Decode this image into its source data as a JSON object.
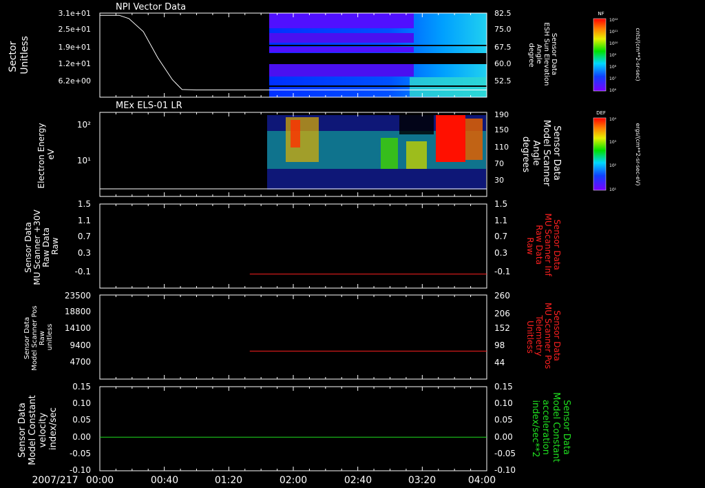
{
  "date_label": "2007/217",
  "time_ticks": [
    "00:00",
    "00:40",
    "01:20",
    "02:00",
    "02:40",
    "03:20",
    "04:00"
  ],
  "colors": {
    "background": "#000000",
    "axis": "#ffffff",
    "red_label": "#ff2020",
    "green_label": "#20e020"
  },
  "colorbars": [
    {
      "tag": "NF",
      "ticks": [
        "10¹²",
        "10¹¹",
        "10¹⁰",
        "10⁹",
        "10⁸",
        "10⁷",
        "10⁶"
      ],
      "unit": "cnts/(cm**2-sr-sec)"
    },
    {
      "tag": "DEF",
      "ticks": [
        "10⁴",
        "10³",
        "10²",
        "10¹"
      ],
      "unit": "ergs/(cm**2-sr-sec-eV)"
    }
  ],
  "chart_data": [
    {
      "type": "heatmap",
      "title": "NPI Vector Data",
      "ylabel_left": [
        "Sector",
        "Unitless"
      ],
      "yticks_left": [
        "3.1e+01",
        "2.5e+01",
        "1.9e+01",
        "1.2e+01",
        "6.2e+00"
      ],
      "ylabel_right": [
        "Sensor Data",
        "ESH Sun Elevation",
        "Angle",
        "degree"
      ],
      "yticks_right": [
        "82.5",
        "75.0",
        "67.5",
        "60.0",
        "52.5"
      ],
      "line": {
        "name": "ESH Sun Elevation Angle",
        "unit": "degree",
        "x_hours": [
          0.0,
          0.2,
          0.3,
          0.45,
          0.6,
          0.75,
          0.85,
          1.0,
          2.0,
          3.0,
          4.0
        ],
        "y": [
          84.5,
          84.5,
          83.0,
          77.0,
          65.0,
          55.0,
          50.5,
          50.3,
          50.3,
          50.3,
          50.3
        ]
      },
      "data_start_hours": 1.58
    },
    {
      "type": "heatmap",
      "title": "MEx ELS-01 LR",
      "ylabel_left": [
        "Electron Energy",
        "eV"
      ],
      "yticks_left": [
        "10²",
        "10¹"
      ],
      "ylabel_right": [
        "Sensor Data",
        "Model Scanner",
        "Angle",
        "degrees"
      ],
      "yticks_right": [
        "190",
        "150",
        "110",
        "70",
        "30"
      ],
      "line": {
        "name": "Model Scanner Angle",
        "unit": "degrees",
        "x_hours": [
          0.0,
          4.0
        ],
        "y": [
          2,
          2
        ]
      },
      "data_start_hours": 1.58
    },
    {
      "type": "line",
      "ylabel_left": [
        "Sensor Data",
        "MU Scanner +30V",
        "Raw Data",
        "Raw"
      ],
      "yticks_left": [
        "1.5",
        "1.1",
        "0.7",
        "0.3",
        "-0.1"
      ],
      "ylabel_right": [
        "Sensor Data",
        "MU Scanner Inf",
        "Raw Data",
        "Raw"
      ],
      "yticks_right": [
        "1.5",
        "1.1",
        "0.7",
        "0.3",
        "-0.1"
      ],
      "ylim": [
        -0.3,
        1.5
      ],
      "series": [
        {
          "name": "MU Scanner Inf Raw Data",
          "x_hours": [
            1.55,
            4.0
          ],
          "y": [
            0.0,
            0.0
          ]
        }
      ]
    },
    {
      "type": "line",
      "ylabel_left": [
        "Sensor Data",
        "Model Scanner Pos",
        "Raw",
        "unitless"
      ],
      "yticks_left": [
        "23500",
        "18800",
        "14100",
        "9400",
        "4700"
      ],
      "ylabel_right": [
        "Sensor Data",
        "MU Scanner Pos",
        "Telemetry",
        "Unitless"
      ],
      "yticks_right": [
        "260",
        "206",
        "152",
        "98",
        "44"
      ],
      "ylim": [
        17,
        260
      ],
      "series": [
        {
          "name": "MU Scanner Pos Telemetry",
          "x_hours": [
            1.55,
            4.0
          ],
          "y": [
            98,
            98
          ]
        }
      ]
    },
    {
      "type": "line",
      "ylabel_left": [
        "Sensor Data",
        "Model Constant",
        "velocity",
        "index/sec"
      ],
      "yticks_left": [
        "0.15",
        "0.10",
        "0.05",
        "0.00",
        "-0.05",
        "-0.10"
      ],
      "ylabel_right": [
        "Sensor Data",
        "Model Constant",
        "acceleration",
        "index/sec**2"
      ],
      "yticks_right": [
        "0.15",
        "0.10",
        "0.05",
        "0.00",
        "-0.05",
        "-0.10"
      ],
      "ylim": [
        -0.1,
        0.15
      ],
      "series": [
        {
          "name": "Model Constant acceleration",
          "x_hours": [
            0.0,
            4.0
          ],
          "y": [
            0.0,
            0.0
          ]
        }
      ]
    }
  ]
}
